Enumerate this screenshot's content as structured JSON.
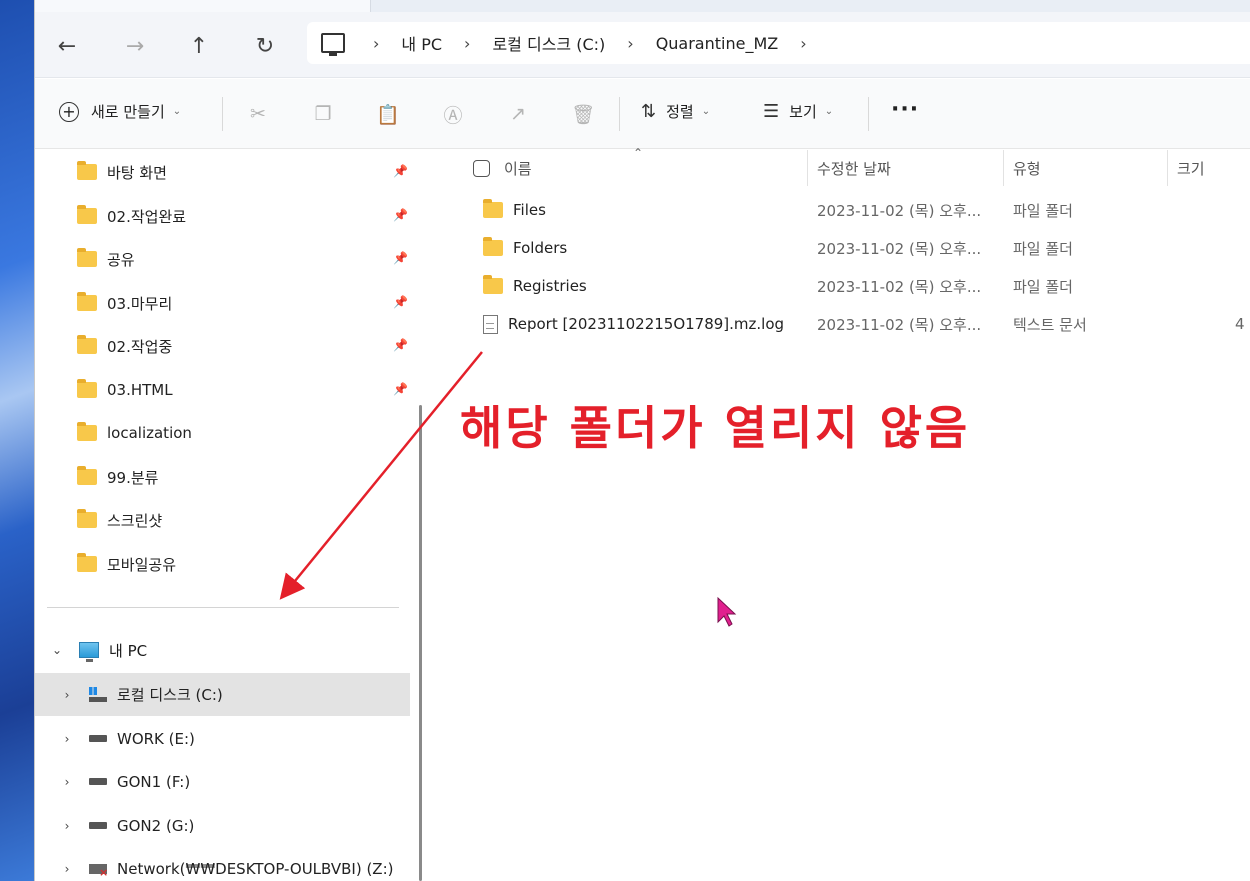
{
  "nav": {
    "back": "←",
    "forward": "→",
    "up": "↑",
    "refresh": "↻",
    "breadcrumbs": [
      "내 PC",
      "로컬 디스크 (C:)",
      "Quarantine_MZ"
    ]
  },
  "commands": {
    "new_label": "새로 만들기",
    "sort_label": "정렬",
    "view_label": "보기",
    "more_label": "···"
  },
  "sidebar": {
    "quick_access": [
      "바탕 화면",
      "02.작업완료",
      "공유",
      "03.마무리",
      "02.작업중",
      "03.HTML",
      "localization",
      "99.분류",
      "스크린샷",
      "모바일공유"
    ],
    "pc_label": "내 PC",
    "drives": [
      "로컬 디스크 (C:)",
      "WORK (E:)",
      "GON1 (F:)",
      "GON2 (G:)",
      "Network(₩₩DESKTOP-OULBVBI) (Z:)"
    ]
  },
  "columns": {
    "name": "이름",
    "date": "수정한 날짜",
    "type": "유형",
    "size": "크기"
  },
  "files": [
    {
      "name": "Files",
      "date": "2023-11-02 (목) 오후...",
      "type": "파일 폴더",
      "size": ""
    },
    {
      "name": "Folders",
      "date": "2023-11-02 (목) 오후...",
      "type": "파일 폴더",
      "size": ""
    },
    {
      "name": "Registries",
      "date": "2023-11-02 (목) 오후...",
      "type": "파일 폴더",
      "size": ""
    },
    {
      "name": "Report [20231102215O1789].mz.log",
      "date": "2023-11-02 (목) 오후...",
      "type": "텍스트 문서",
      "size": "4"
    }
  ],
  "annotation": "해당 폴더가 열리지 않음",
  "colors": {
    "annotation": "#e4202a",
    "folder": "#f8c84a",
    "selected_row": "#e3e3e3"
  }
}
